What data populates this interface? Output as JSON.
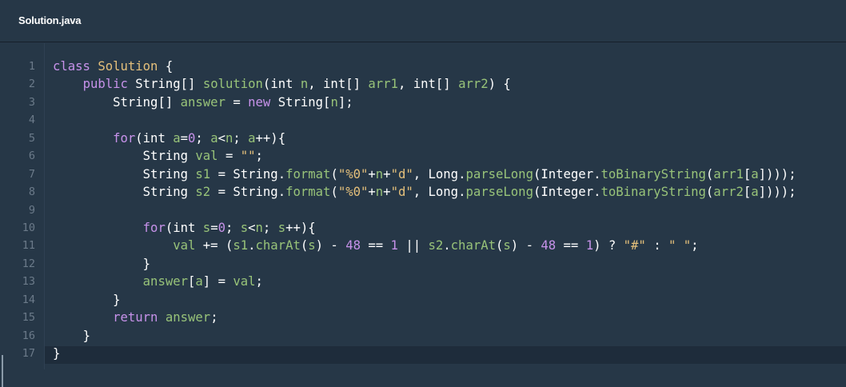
{
  "tab": {
    "title": "Solution.java"
  },
  "editor": {
    "line_numbers": [
      "1",
      "2",
      "3",
      "4",
      "5",
      "6",
      "7",
      "8",
      "9",
      "10",
      "11",
      "12",
      "13",
      "14",
      "15",
      "16",
      "17"
    ],
    "lines": [
      "class Solution {",
      "    public String[] solution(int n, int[] arr1, int[] arr2) {",
      "        String[] answer = new String[n];",
      "",
      "        for(int a=0; a<n; a++){",
      "            String val = \"\";",
      "            String s1 = String.format(\"%0\"+n+\"d\", Long.parseLong(Integer.toBinaryString(arr1[a])));",
      "            String s2 = String.format(\"%0\"+n+\"d\", Long.parseLong(Integer.toBinaryString(arr2[a])));",
      "",
      "            for(int s=0; s<n; s++){",
      "                val += (s1.charAt(s) - 48 == 1 || s2.charAt(s) - 48 == 1) ? \"#\" : \" \";",
      "            }",
      "            answer[a] = val;",
      "        }",
      "        return answer;",
      "    }",
      "}"
    ]
  }
}
